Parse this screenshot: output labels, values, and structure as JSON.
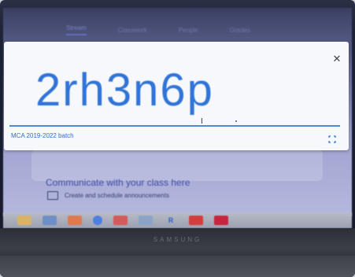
{
  "tabs": [
    "Stream",
    "Classwork",
    "People",
    "Grades"
  ],
  "modal": {
    "class_code": "2rh3n6p",
    "class_name": "MCA 2019-2022 batch",
    "close_icon": "close-icon",
    "fullscreen_icon": "fullscreen-icon"
  },
  "stream": {
    "communicate_text": "Communicate with your class here",
    "schedule_text": "Create and schedule announcements"
  },
  "taskbar": {
    "icons": [
      "file-explorer-icon",
      "mail-icon",
      "media-icon",
      "chrome-icon",
      "photos-icon",
      "r-icon",
      "app-icon",
      "app-red-icon"
    ],
    "r_label": "R"
  },
  "laptop": {
    "brand": "SAMSUNG"
  },
  "colors": {
    "code_blue": "#2f74d6",
    "page_purple": "#9ea2cf",
    "modal_bg": "#f7f8fb"
  }
}
